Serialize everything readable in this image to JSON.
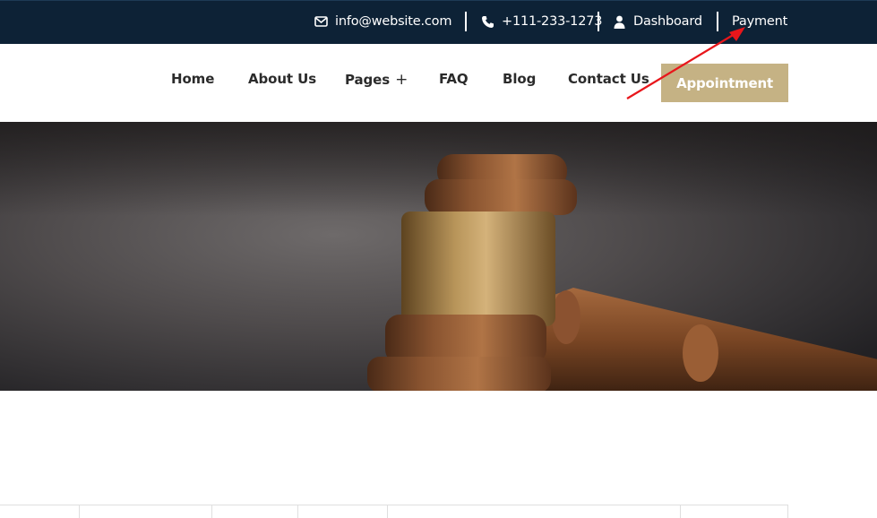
{
  "topbar": {
    "email": "info@website.com",
    "phone": "+111-233-1273",
    "dashboard_label": "Dashboard",
    "payment_label": "Payment"
  },
  "nav": {
    "items": [
      {
        "label": "Home"
      },
      {
        "label": "About Us"
      },
      {
        "label": "Pages",
        "suffix": "+"
      },
      {
        "label": "FAQ"
      },
      {
        "label": "Blog"
      },
      {
        "label": "Contact Us"
      }
    ],
    "cta_label": "Appointment"
  },
  "hero": {
    "image": "gavel-photo"
  },
  "colors": {
    "topbar_bg": "#0d2236",
    "accent": "#c5b284",
    "annotation_arrow": "#e8161b"
  },
  "icons": {
    "email": "envelope-icon",
    "phone": "phone-icon",
    "dashboard": "user-icon"
  }
}
